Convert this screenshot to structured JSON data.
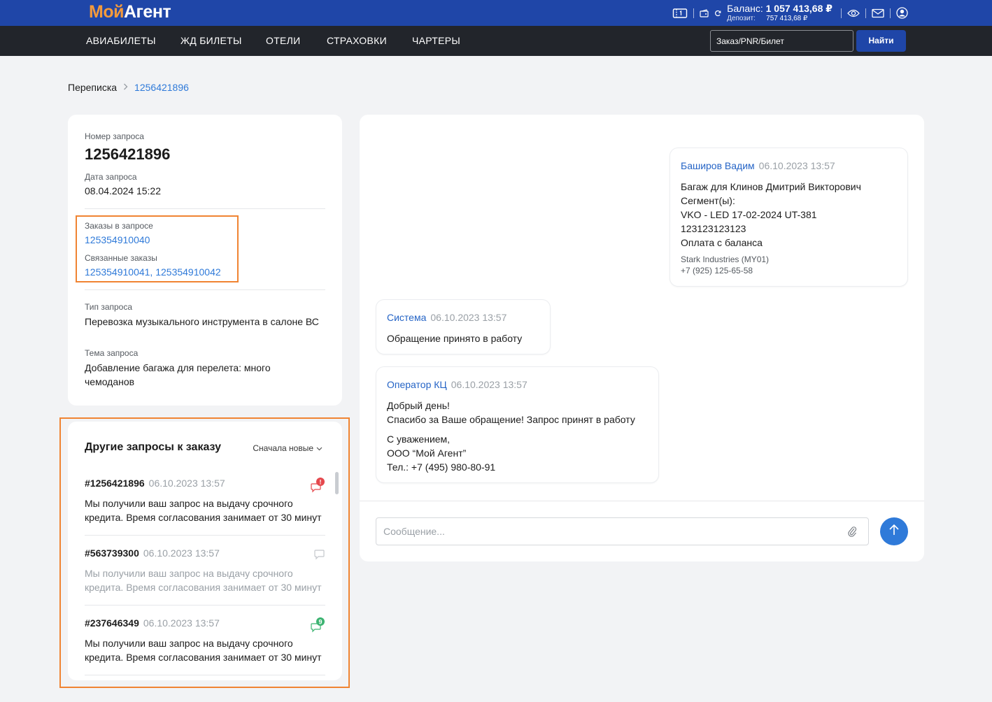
{
  "header": {
    "logo_part1": "Мой",
    "logo_part2": "Агент",
    "balance_label": "Баланс:",
    "balance_value": "1 057 413,68 ₽",
    "deposit_label": "Депозит:",
    "deposit_value": "757 413,68 ₽",
    "icons": [
      "ticket-icon",
      "wallet-icon",
      "refresh-icon",
      "eye-icon",
      "mail-icon",
      "user-icon"
    ]
  },
  "nav": {
    "items": [
      "АВИАБИЛЕТЫ",
      "ЖД БИЛЕТЫ",
      "ОТЕЛИ",
      "СТРАХОВКИ",
      "ЧАРТЕРЫ"
    ],
    "search_placeholder": "Заказ/PNR/Билет",
    "search_button": "Найти"
  },
  "breadcrumb": {
    "parent": "Переписка",
    "current": "1256421896"
  },
  "request_info": {
    "number_label": "Номер запроса",
    "number": "1256421896",
    "date_label": "Дата запроса",
    "date": "08.04.2024 15:22",
    "orders_label": "Заказы в запросе",
    "orders": "125354910040",
    "related_label": "Связанные заказы",
    "related": "125354910041, 125354910042",
    "type_label": "Тип запроса",
    "type": "Перевозка музыкального инструмента в салоне ВС",
    "topic_label": "Тема запроса",
    "topic": "Добавление багажа для перелета: много чемоданов"
  },
  "other_requests": {
    "title": "Другие запросы к заказу",
    "sort_label": "Сначала новые",
    "items": [
      {
        "number": "#1256421896",
        "date": "06.10.2023 13:57",
        "line1": "Мы получили ваш запрос на выдачу срочного",
        "line2": "кредита. Время согласования занимает от 30 минут",
        "badge": "!",
        "state": "unread-alert"
      },
      {
        "number": "#563739300",
        "date": "06.10.2023 13:57",
        "line1": "Мы получили ваш запрос на выдачу срочного",
        "line2": "кредита. Время согласования занимает от 30 минут",
        "badge": "",
        "state": "read"
      },
      {
        "number": "#237646349",
        "date": "06.10.2023 13:57",
        "line1": "Мы получили ваш запрос на выдачу срочного",
        "line2": "кредита. Время согласования занимает от 30 минут",
        "badge": "9",
        "state": "unread-count"
      }
    ]
  },
  "chat": {
    "messages": [
      {
        "author": "Баширов Вадим",
        "date": "06.10.2023 13:57",
        "lines": [
          "Багаж для Клинов Дмитрий Викторович",
          "Сегмент(ы):",
          "VKO - LED 17-02-2024 UT-381",
          "123123123123",
          "Оплата с баланса"
        ],
        "footer": [
          "Stark Industries (MY01)",
          "+7 (925) 125-65-58"
        ]
      },
      {
        "author": "Система",
        "date": "06.10.2023 13:57",
        "lines": [
          "Обращение принято в работу"
        ]
      },
      {
        "author": "Оператор КЦ",
        "date": "06.10.2023 13:57",
        "lines": [
          "Добрый день!",
          "Спасибо за Ваше обращение! Запрос принят в работу"
        ],
        "lines2": [
          "С уважением,",
          "ООО “Мой Агент”",
          "Тел.: +7 (495) 980-80-91"
        ]
      }
    ],
    "input_placeholder": "Сообщение..."
  },
  "colors": {
    "header_blue": "#1f46a8",
    "nav_dark": "#22252b",
    "link_blue": "#2f7ad9",
    "highlight_orange": "#f08432",
    "alert_red": "#e5484d",
    "count_green": "#3cb371"
  }
}
